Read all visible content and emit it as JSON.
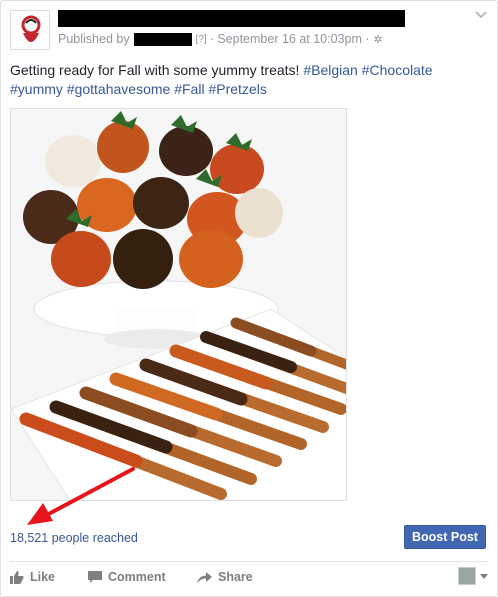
{
  "post": {
    "published_prefix": "Published by",
    "help_marker": "[?]",
    "timestamp": "· September 16 at 10:03pm ·",
    "message_lead": "Getting ready for Fall with some yummy treats! ",
    "hashtags": [
      "#Belgian",
      "#Chocolate",
      "#yummy",
      "#gottahavesome",
      "#Fall",
      "#Pretzels"
    ]
  },
  "insights": {
    "reach_text": "18,521 people reached",
    "boost_label": "Boost Post"
  },
  "actions": {
    "like": "Like",
    "comment": "Comment",
    "share": "Share"
  },
  "icons": {
    "chevron": "chevron-down-icon",
    "gear": "gear-icon",
    "like": "thumbs-up-icon",
    "comment": "speech-bubble-icon",
    "share": "share-arrow-icon"
  },
  "colors": {
    "link": "#365899",
    "button": "#4267b2",
    "annotation_arrow": "#e8141c"
  }
}
